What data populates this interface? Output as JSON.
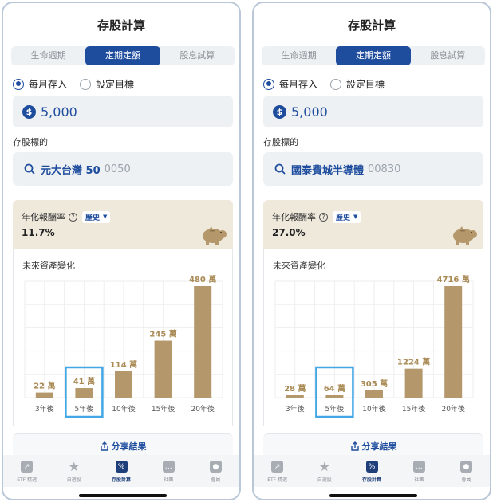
{
  "colors": {
    "accent": "#1f4d9e",
    "bar": "#b4986b",
    "highlight": "#43a7e5",
    "beige": "#efe9dc"
  },
  "screens": [
    {
      "title": "存股計算",
      "tabs": [
        "生命週期",
        "定期定額",
        "股息試算"
      ],
      "active_tab": 1,
      "radios": {
        "monthly": "每月存入",
        "target": "設定目標",
        "selected": "monthly"
      },
      "amount_icon": "dollar-icon",
      "amount": "5,000",
      "stock_label": "存股標的",
      "stock_name": "元大台灣 50",
      "stock_code": "0050",
      "return_label": "年化報酬率",
      "return_mode": "歷史",
      "return_value": "11.7%",
      "chart_title": "未來資產變化",
      "share_label": "分享結果",
      "nav": [
        "ETF 精選",
        "自選股",
        "存股計算",
        "社團",
        "會員"
      ],
      "active_nav": 2
    },
    {
      "title": "存股計算",
      "tabs": [
        "生命週期",
        "定期定額",
        "股息試算"
      ],
      "active_tab": 1,
      "radios": {
        "monthly": "每月存入",
        "target": "設定目標",
        "selected": "monthly"
      },
      "amount_icon": "dollar-icon",
      "amount": "5,000",
      "stock_label": "存股標的",
      "stock_name": "國泰費城半導體",
      "stock_code": "00830",
      "return_label": "年化報酬率",
      "return_mode": "歷史",
      "return_value": "27.0%",
      "chart_title": "未來資產變化",
      "share_label": "分享結果",
      "nav": [
        "ETF 精選",
        "自選股",
        "存股計算",
        "社團",
        "會員"
      ],
      "active_nav": 2
    }
  ],
  "chart_data": [
    {
      "type": "bar",
      "title": "未來資產變化",
      "categories": [
        "3年後",
        "5年後",
        "10年後",
        "15年後",
        "20年後"
      ],
      "values": [
        22,
        41,
        114,
        245,
        480
      ],
      "value_labels": [
        "22 萬",
        "41 萬",
        "114 萬",
        "245 萬",
        "480 萬"
      ],
      "unit": "萬",
      "highlighted_category": "5年後",
      "grid": true
    },
    {
      "type": "bar",
      "title": "未來資產變化",
      "categories": [
        "3年後",
        "5年後",
        "10年後",
        "15年後",
        "20年後"
      ],
      "values": [
        28,
        64,
        305,
        1224,
        4716
      ],
      "value_labels": [
        "28 萬",
        "64 萬",
        "305 萬",
        "1224 萬",
        "4716 萬"
      ],
      "unit": "萬",
      "highlighted_category": "5年後",
      "grid": true
    }
  ]
}
